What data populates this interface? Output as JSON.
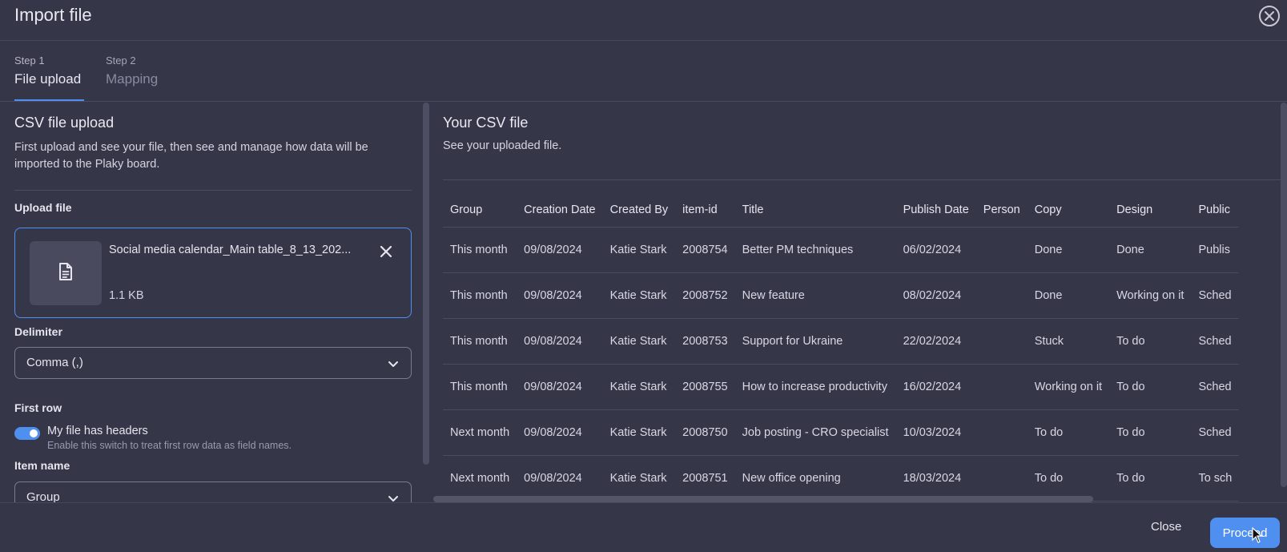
{
  "header": {
    "title": "Import file",
    "close_icon": "close-circle-icon"
  },
  "steps": [
    {
      "number": "Step 1",
      "label": "File upload",
      "active": true
    },
    {
      "number": "Step 2",
      "label": "Mapping",
      "active": false
    }
  ],
  "upload": {
    "title": "CSV file upload",
    "description": "First upload and see your file, then see and manage how data will be imported to the Plaky board.",
    "upload_label": "Upload file",
    "file": {
      "name": "Social media calendar_Main table_8_13_202...",
      "size": "1.1 KB",
      "icon": "document-icon"
    },
    "delimiter": {
      "label": "Delimiter",
      "value": "Comma (,)"
    },
    "first_row": {
      "label": "First row",
      "toggle_label": "My file has headers",
      "help": "Enable this switch to treat first row data as field names.",
      "enabled": true
    },
    "item_name": {
      "label": "Item name",
      "value": "Group"
    }
  },
  "preview": {
    "title": "Your CSV file",
    "description": "See your uploaded file.",
    "columns": [
      "Group",
      "Creation Date",
      "Created By",
      "item-id",
      "Title",
      "Publish Date",
      "Person",
      "Copy",
      "Design",
      "Public"
    ],
    "rows": [
      [
        "This month",
        "09/08/2024",
        "Katie Stark",
        "2008754",
        "Better PM techniques",
        "06/02/2024",
        "",
        "Done",
        "Done",
        "Publis"
      ],
      [
        "This month",
        "09/08/2024",
        "Katie Stark",
        "2008752",
        "New feature",
        "08/02/2024",
        "",
        "Done",
        "Working on it",
        "Sched"
      ],
      [
        "This month",
        "09/08/2024",
        "Katie Stark",
        "2008753",
        "Support for Ukraine",
        "22/02/2024",
        "",
        "Stuck",
        "To do",
        "Sched"
      ],
      [
        "This month",
        "09/08/2024",
        "Katie Stark",
        "2008755",
        "How to increase productivity",
        "16/02/2024",
        "",
        "Working on it",
        "To do",
        "Sched"
      ],
      [
        "Next month",
        "09/08/2024",
        "Katie Stark",
        "2008750",
        "Job posting - CRO specialist",
        "10/03/2024",
        "",
        "To do",
        "To do",
        "Sched"
      ],
      [
        "Next month",
        "09/08/2024",
        "Katie Stark",
        "2008751",
        "New office opening",
        "18/03/2024",
        "",
        "To do",
        "To do",
        "To sch"
      ]
    ]
  },
  "footer": {
    "close_label": "Close",
    "proceed_label": "Proceed"
  },
  "colors": {
    "accent": "#4f8ff0",
    "background": "#363649"
  }
}
